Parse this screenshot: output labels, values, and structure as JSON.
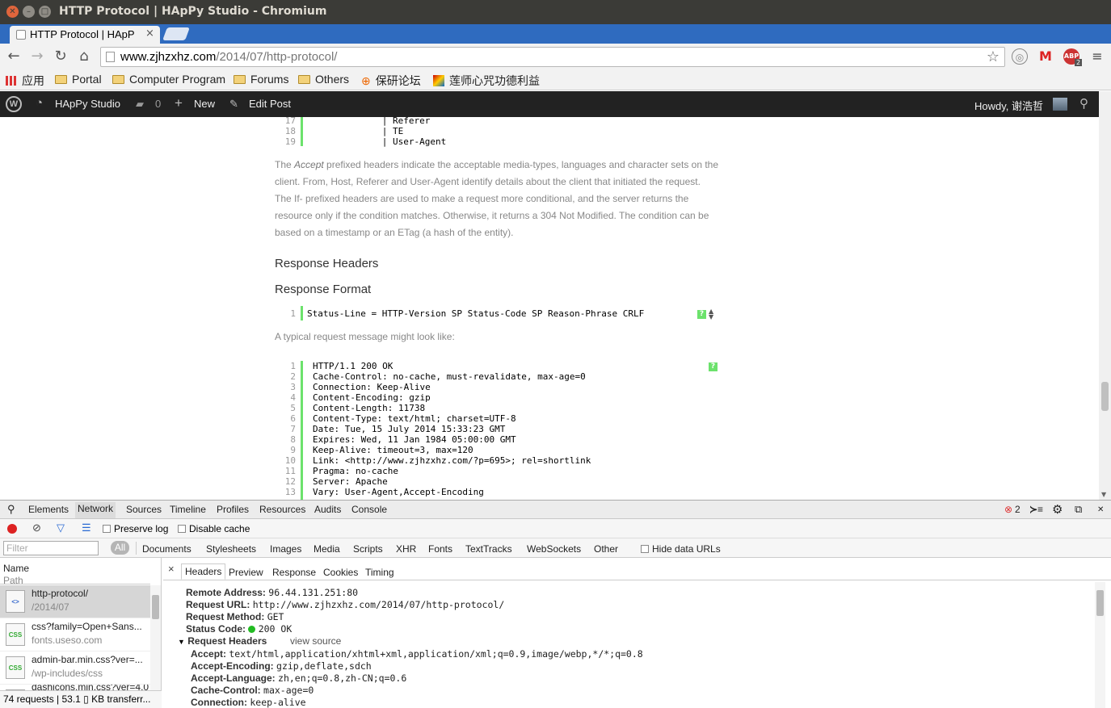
{
  "window": {
    "title": "HTTP Protocol | HApPy Studio - Chromium"
  },
  "tab": {
    "title": "HTTP Protocol | HApP",
    "close": "×"
  },
  "omnibox": {
    "url_host": "www.zjhzxhz.com",
    "url_path": "/2014/07/http-protocol/"
  },
  "extensions": {
    "abp": "ABP",
    "abp_badge": "2"
  },
  "bookmarks": [
    "应用",
    "Portal",
    "Computer Program",
    "Forums",
    "Others",
    "保研论坛",
    "莲师心咒功德利益"
  ],
  "wpbar": {
    "site": "HApPy Studio",
    "comments": "0",
    "new": "New",
    "edit": "Edit Post",
    "howdy": "Howdy, 谢浩哲"
  },
  "article": {
    "code1": [
      {
        "n": "17",
        "t": "              | Referer"
      },
      {
        "n": "18",
        "t": "              | TE"
      },
      {
        "n": "19",
        "t": "              | User-Agent"
      }
    ],
    "para1_pre": "The ",
    "para1_em": "Accept",
    "para1_post": " prefixed headers indicate the acceptable media-types, languages and character sets on the client. From, Host, Referer and User-Agent identify details about the client that initiated the request. The If- prefixed headers are used to make a request more conditional, and the server returns the resource only if the condition matches. Otherwise, it returns a 304 Not Modified. The condition can be based on a timestamp or an ETag (a hash of the entity).",
    "h_response_headers": "Response Headers",
    "h_response_format": "Response Format",
    "code2_num": "1",
    "code2": "Status-Line = HTTP-Version SP Status-Code SP Reason-Phrase CRLF",
    "para2": "A typical request message might look like:",
    "code3": [
      {
        "n": "1",
        "t": "HTTP/1.1 200 OK"
      },
      {
        "n": "2",
        "t": "Cache-Control: no-cache, must-revalidate, max-age=0"
      },
      {
        "n": "3",
        "t": "Connection: Keep-Alive"
      },
      {
        "n": "4",
        "t": "Content-Encoding: gzip"
      },
      {
        "n": "5",
        "t": "Content-Length: 11738"
      },
      {
        "n": "6",
        "t": "Content-Type: text/html; charset=UTF-8"
      },
      {
        "n": "7",
        "t": "Date: Tue, 15 July 2014 15:33:23 GMT"
      },
      {
        "n": "8",
        "t": "Expires: Wed, 11 Jan 1984 05:00:00 GMT"
      },
      {
        "n": "9",
        "t": "Keep-Alive: timeout=3, max=120"
      },
      {
        "n": "10",
        "t": "Link: <http://www.zjhzxhz.com/?p=695>; rel=shortlink"
      },
      {
        "n": "11",
        "t": "Pragma: no-cache"
      },
      {
        "n": "12",
        "t": "Server: Apache"
      },
      {
        "n": "13",
        "t": "Vary: User-Agent,Accept-Encoding"
      }
    ],
    "qmark": "?"
  },
  "devtools": {
    "tabs": [
      "Elements",
      "Network",
      "Sources",
      "Timeline",
      "Profiles",
      "Resources",
      "Audits",
      "Console"
    ],
    "errors": "2",
    "preserve_log": "Preserve log",
    "disable_cache": "Disable cache",
    "filter_placeholder": "Filter",
    "all": "All",
    "types": [
      "Documents",
      "Stylesheets",
      "Images",
      "Media",
      "Scripts",
      "XHR",
      "Fonts",
      "TextTracks",
      "WebSockets",
      "Other"
    ],
    "hide_data_urls": "Hide data URLs",
    "col_name": "Name",
    "col_path": "Path",
    "requests": [
      {
        "name": "http-protocol/",
        "path": "/2014/07",
        "type": "<>"
      },
      {
        "name": "css?family=Open+Sans...",
        "path": "fonts.useso.com",
        "type": "CSS"
      },
      {
        "name": "admin-bar.min.css?ver=...",
        "path": "/wp-includes/css",
        "type": "CSS"
      },
      {
        "name": "dashicons.min.css?ver=4.0",
        "path": "",
        "type": "CSS"
      }
    ],
    "status_bar": "74 requests | 53.1 ▯ KB transferr...",
    "detail_close": "×",
    "detail_tabs": [
      "Headers",
      "Preview",
      "Response",
      "Cookies",
      "Timing"
    ],
    "headers": {
      "remote_address_k": "Remote Address:",
      "remote_address_v": "96.44.131.251:80",
      "request_url_k": "Request URL:",
      "request_url_v": "http://www.zjhzxhz.com/2014/07/http-protocol/",
      "request_method_k": "Request Method:",
      "request_method_v": "GET",
      "status_code_k": "Status Code:",
      "status_code_v": "200 OK",
      "request_headers": "Request Headers",
      "view_source": "view source",
      "accept_k": "Accept:",
      "accept_v": "text/html,application/xhtml+xml,application/xml;q=0.9,image/webp,*/*;q=0.8",
      "accept_encoding_k": "Accept-Encoding:",
      "accept_encoding_v": "gzip,deflate,sdch",
      "accept_language_k": "Accept-Language:",
      "accept_language_v": "zh,en;q=0.8,zh-CN;q=0.6",
      "cache_control_k": "Cache-Control:",
      "cache_control_v": "max-age=0",
      "connection_k": "Connection:",
      "connection_v": "keep-alive"
    }
  }
}
